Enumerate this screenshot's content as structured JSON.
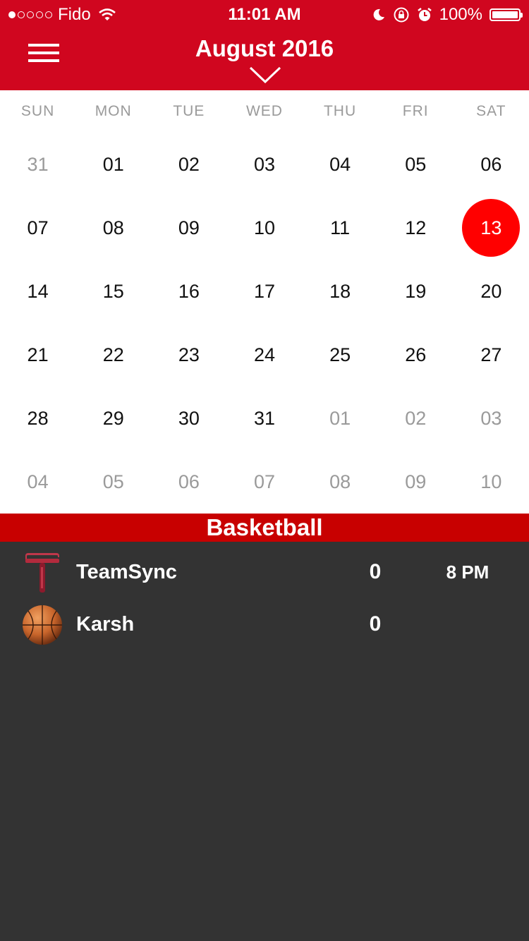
{
  "status_bar": {
    "carrier": "Fido",
    "time": "11:01 AM",
    "battery": "100%",
    "signal_dots_filled": 1,
    "signal_dots_total": 5
  },
  "header": {
    "title": "August 2016"
  },
  "calendar": {
    "weekdays": [
      "SUN",
      "MON",
      "TUE",
      "WED",
      "THU",
      "FRI",
      "SAT"
    ],
    "days": [
      {
        "label": "31",
        "muted": true
      },
      {
        "label": "01"
      },
      {
        "label": "02"
      },
      {
        "label": "03"
      },
      {
        "label": "04"
      },
      {
        "label": "05"
      },
      {
        "label": "06"
      },
      {
        "label": "07"
      },
      {
        "label": "08"
      },
      {
        "label": "09"
      },
      {
        "label": "10"
      },
      {
        "label": "11"
      },
      {
        "label": "12"
      },
      {
        "label": "13",
        "selected": true
      },
      {
        "label": "14"
      },
      {
        "label": "15"
      },
      {
        "label": "16"
      },
      {
        "label": "17"
      },
      {
        "label": "18"
      },
      {
        "label": "19"
      },
      {
        "label": "20"
      },
      {
        "label": "21"
      },
      {
        "label": "22"
      },
      {
        "label": "23"
      },
      {
        "label": "24"
      },
      {
        "label": "25"
      },
      {
        "label": "26"
      },
      {
        "label": "27"
      },
      {
        "label": "28"
      },
      {
        "label": "29"
      },
      {
        "label": "30"
      },
      {
        "label": "31"
      },
      {
        "label": "01",
        "muted": true
      },
      {
        "label": "02",
        "muted": true
      },
      {
        "label": "03",
        "muted": true
      },
      {
        "label": "04",
        "muted": true
      },
      {
        "label": "05",
        "muted": true
      },
      {
        "label": "06",
        "muted": true
      },
      {
        "label": "07",
        "muted": true
      },
      {
        "label": "08",
        "muted": true
      },
      {
        "label": "09",
        "muted": true
      },
      {
        "label": "10",
        "muted": true
      }
    ]
  },
  "events": {
    "sport": "Basketball",
    "game": {
      "time": "8 PM",
      "teams": [
        {
          "name": "TeamSync",
          "score": "0",
          "logo": "teamsync-logo-icon"
        },
        {
          "name": "Karsh",
          "score": "0",
          "logo": "basketball-icon"
        }
      ]
    }
  },
  "colors": {
    "header": "#D0061F",
    "selected_day": "#FF0000",
    "sport_bar": "#C80000",
    "events_bg": "#333333"
  }
}
